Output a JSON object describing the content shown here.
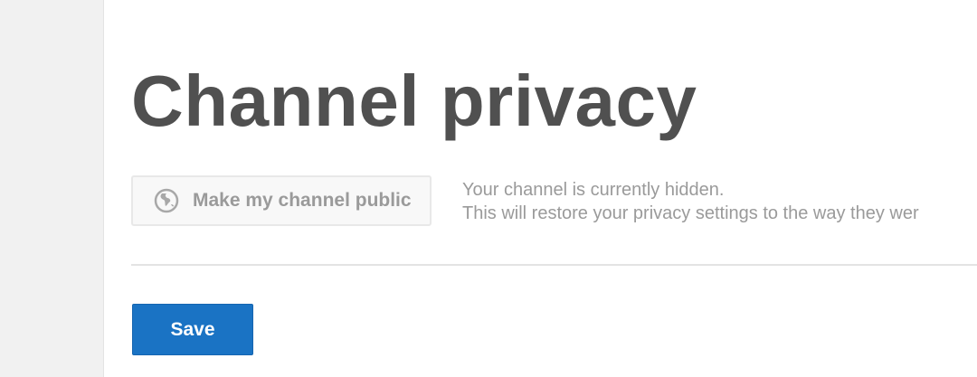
{
  "page": {
    "title": "Channel privacy"
  },
  "privacy": {
    "public_button_label": "Make my channel public",
    "public_button_icon": "globe-icon",
    "status_line_1": "Your channel is currently hidden.",
    "status_line_2": "This will restore your privacy settings to the way they wer"
  },
  "actions": {
    "save_label": "Save"
  },
  "colors": {
    "accent": "#1a73c4",
    "title": "#505050",
    "muted_text": "#9a9a9a",
    "sidebar_bg": "#f1f1f1"
  }
}
